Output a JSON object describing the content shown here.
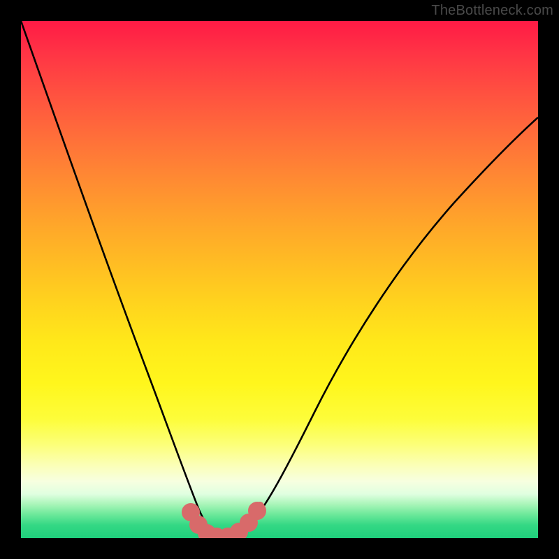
{
  "watermark": "TheBottleneck.com",
  "chart_data": {
    "type": "line",
    "title": "",
    "xlabel": "",
    "ylabel": "",
    "xlim": [
      0,
      1
    ],
    "ylim": [
      0,
      1
    ],
    "series": [
      {
        "name": "bottleneck-curve",
        "color": "#000000",
        "x": [
          0.0,
          0.035,
          0.07,
          0.105,
          0.14,
          0.175,
          0.21,
          0.245,
          0.28,
          0.3,
          0.32,
          0.34,
          0.355,
          0.365,
          0.378,
          0.398,
          0.425,
          0.455,
          0.475,
          0.5,
          0.54,
          0.59,
          0.65,
          0.72,
          0.8,
          0.88,
          0.96,
          1.0
        ],
        "y": [
          1.0,
          0.89,
          0.78,
          0.67,
          0.56,
          0.45,
          0.34,
          0.235,
          0.14,
          0.095,
          0.06,
          0.032,
          0.015,
          0.008,
          0.004,
          0.004,
          0.008,
          0.02,
          0.038,
          0.07,
          0.135,
          0.215,
          0.305,
          0.4,
          0.5,
          0.59,
          0.67,
          0.706
        ]
      },
      {
        "name": "highlight-band",
        "color": "#d86a6a",
        "x": [
          0.33,
          0.345,
          0.36,
          0.378,
          0.398,
          0.42,
          0.445,
          0.46
        ],
        "y": [
          0.05,
          0.025,
          0.012,
          0.006,
          0.006,
          0.01,
          0.022,
          0.035
        ]
      }
    ]
  }
}
